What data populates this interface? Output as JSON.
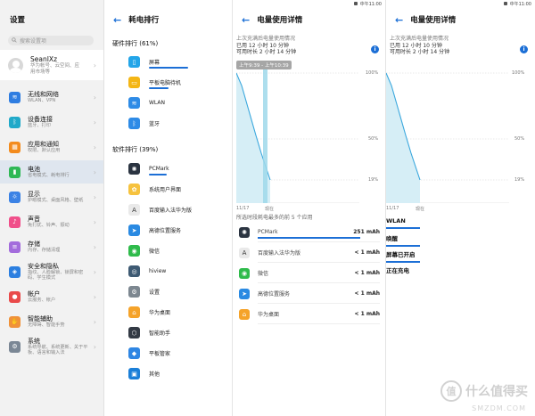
{
  "status_time": "中午11:00",
  "pane1": {
    "title": "设置",
    "search_placeholder": "搜索设置项",
    "profile": {
      "name": "SeanIXz",
      "sub": "华为帐号、云空间、应用市场等"
    },
    "items": [
      {
        "title": "无线和网络",
        "sub": "WLAN、VPN",
        "icon": "wifi-icon",
        "color": "#2e7de1"
      },
      {
        "title": "设备连接",
        "sub": "蓝牙、打印",
        "icon": "bluetooth-icon",
        "color": "#20a9c9"
      },
      {
        "title": "应用和通知",
        "sub": "权限、默认应用",
        "icon": "apps-icon",
        "color": "#f38b1d"
      },
      {
        "title": "电池",
        "sub": "省电模式、耗电排行",
        "icon": "battery-icon",
        "color": "#2fb855"
      },
      {
        "title": "显示",
        "sub": "护眼模式、桌面风格、壁纸",
        "icon": "display-icon",
        "color": "#3b82e5"
      },
      {
        "title": "声音",
        "sub": "免打扰、铃声、振动",
        "icon": "sound-icon",
        "color": "#f04f8a"
      },
      {
        "title": "存储",
        "sub": "内存、存储清理",
        "icon": "storage-icon",
        "color": "#a36cdc"
      },
      {
        "title": "安全和隐私",
        "sub": "指纹、人脸解锁、锁屏和密码、学生模式",
        "icon": "shield-icon",
        "color": "#2c7fe0"
      },
      {
        "title": "帐户",
        "sub": "云服务、帐户",
        "icon": "account-icon",
        "color": "#e94a4a"
      },
      {
        "title": "智能辅助",
        "sub": "无障碍、智能手势",
        "icon": "hand-icon",
        "color": "#f0923a"
      },
      {
        "title": "系统",
        "sub": "系统导航、系统更新、关于平板、语言和输入法",
        "icon": "system-icon",
        "color": "#7b8795"
      }
    ]
  },
  "pane2": {
    "title": "耗电排行",
    "hardware_title": "硬件排行 (61%)",
    "hardware": [
      {
        "name": "屏幕",
        "icon": "screen-icon",
        "color": "#23a5e8",
        "bar": 0.55
      },
      {
        "name": "平板电脑待机",
        "icon": "tablet-standby-icon",
        "color": "#f4b615",
        "bar": 0.28
      },
      {
        "name": "WLAN",
        "icon": "wifi-icon",
        "color": "#2e8be6",
        "bar": 0
      },
      {
        "name": "蓝牙",
        "icon": "bluetooth-icon",
        "color": "#2e8be6",
        "bar": 0
      }
    ],
    "software_title": "软件排行 (39%)",
    "software": [
      {
        "name": "PCMark",
        "icon": "pcmark-icon",
        "color": "#2b3441",
        "bar": 0.25
      },
      {
        "name": "系统用户界面",
        "icon": "system-ui-icon",
        "color": "#f6c23e",
        "bar": 0
      },
      {
        "name": "百度输入法华为版",
        "icon": "baidu-ime-icon",
        "color": "#e9e9e9",
        "bar": 0
      },
      {
        "name": "高德位置服务",
        "icon": "location-icon",
        "color": "#2a8ae2",
        "bar": 0
      },
      {
        "name": "微信",
        "icon": "wechat-icon",
        "color": "#2fbb4b",
        "bar": 0
      },
      {
        "name": "hiview",
        "icon": "hiview-icon",
        "color": "#3e5a73",
        "bar": 0
      },
      {
        "name": "设置",
        "icon": "settings-icon",
        "color": "#7d8790",
        "bar": 0
      },
      {
        "name": "华为桌面",
        "icon": "home-icon",
        "color": "#f5a32a",
        "bar": 0
      },
      {
        "name": "智能助手",
        "icon": "assistant-icon",
        "color": "#333a44",
        "bar": 0
      },
      {
        "name": "平板管家",
        "icon": "manager-icon",
        "color": "#2f86e3",
        "bar": 0
      },
      {
        "name": "其他",
        "icon": "other-icon",
        "color": "#1b7fd8",
        "bar": 0
      }
    ]
  },
  "pane3": {
    "title": "电量使用详情",
    "line1": "上次充满后电量使用情况",
    "line2": "已用 12 小时 10 分钟",
    "line3": "可用时长 2 小时 14 分钟",
    "chip": "上午9:39 - 上午10:39",
    "axis": {
      "y_top": "100%",
      "y_mid": "50%",
      "y_low": "19%",
      "x_start": "11/17",
      "x_end": "现在"
    },
    "apps_title": "所选时段耗电最多的前 5 个应用",
    "apps": [
      {
        "name": "PCMark",
        "value": "251 mAh",
        "icon": "pcmark-icon",
        "color": "#2b3441",
        "bar": 0.82
      },
      {
        "name": "百度输入法华为版",
        "value": "< 1 mAh",
        "icon": "baidu-ime-icon",
        "color": "#e9e9e9",
        "bar": 0
      },
      {
        "name": "微信",
        "value": "< 1 mAh",
        "icon": "wechat-icon",
        "color": "#2fbb4b",
        "bar": 0
      },
      {
        "name": "高德位置服务",
        "value": "< 1 mAh",
        "icon": "location-icon",
        "color": "#2a8ae2",
        "bar": 0
      },
      {
        "name": "华为桌面",
        "value": "< 1 mAh",
        "icon": "home-icon",
        "color": "#f5a32a",
        "bar": 0
      }
    ]
  },
  "pane4": {
    "title": "电量使用详情",
    "line1": "上次充满后电量使用情况",
    "line2": "已用 12 小时 10 分钟",
    "line3": "可用时长 2 小时 14 分钟",
    "axis": {
      "y_top": "100%",
      "y_mid": "50%",
      "y_low": "19%",
      "x_start": "11/17",
      "x_end": "现在"
    },
    "states": [
      {
        "label": "WLAN",
        "bar": true
      },
      {
        "label": "唤醒",
        "bar": true
      },
      {
        "label": "屏幕已开启",
        "bar": true
      },
      {
        "label": "正在充电",
        "bar": false
      }
    ]
  },
  "watermark": {
    "text": "什么值得买",
    "circle": "值",
    "sub": "SMZDM.COM"
  }
}
